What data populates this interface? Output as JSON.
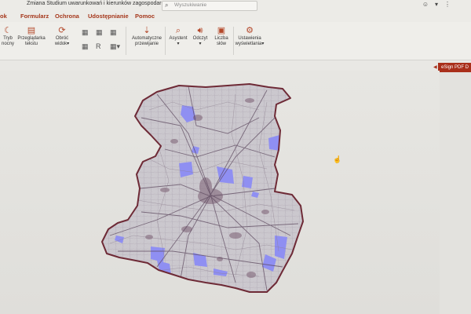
{
  "window": {
    "doc_title": "Zmiana Studium uwarunkowań i kierunków zagospodaro...",
    "search_placeholder": "Wyszukiwanie"
  },
  "tabs": [
    {
      "label": "ok"
    },
    {
      "label": "Formularz"
    },
    {
      "label": "Ochrona"
    },
    {
      "label": "Udostępnianie"
    },
    {
      "label": "Pomoc"
    }
  ],
  "ribbon": {
    "tryb_label_1": "Tryb",
    "tryb_label_2": "nocny",
    "przegladarka_label_1": "Przeglądarka",
    "przegladarka_label_2": "tekstu",
    "obroc_label_1": "Obróć",
    "obroc_label_2": "widok",
    "auto_label_1": "Automatyczne",
    "auto_label_2": "przewijanie",
    "asystent_label": "Asystent",
    "odczyt_label": "Odczyt",
    "liczba_label_1": "Liczba",
    "liczba_label_2": "słów",
    "ustawienia_label_1": "Ustawienia",
    "ustawienia_label_2": "wyświetlania",
    "icon_names": [
      "moon-icon",
      "text-viewer-icon",
      "rotate-icon",
      "auto-scroll-icon",
      "assistant-icon",
      "speaker-icon",
      "word-count-icon",
      "display-settings-icon"
    ]
  },
  "side_panel": {
    "esign_label": "eSign PDF D"
  },
  "map": {
    "accent_blue": "#8f8ff2",
    "boundary_color": "#6e2a36",
    "fill_color": "#c8c5cc"
  }
}
